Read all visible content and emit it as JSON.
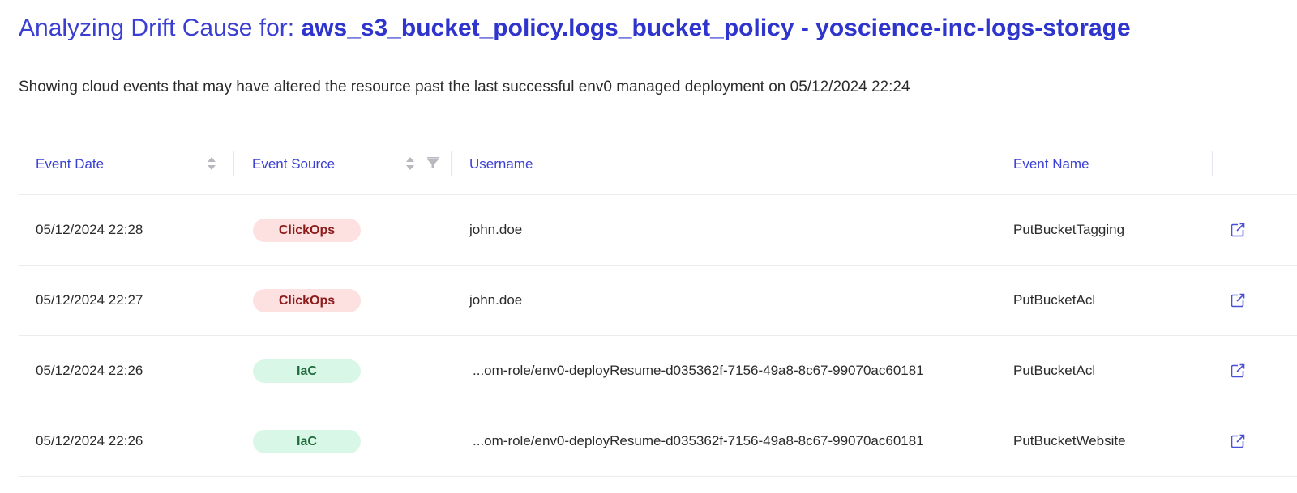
{
  "page": {
    "title_prefix": "Analyzing Drift Cause for: ",
    "title_resource": "aws_s3_bucket_policy.logs_bucket_policy - yoscience-inc-logs-storage",
    "subtitle": "Showing cloud events that may have altered the resource past the last successful env0 managed deployment on 05/12/2024 22:24"
  },
  "table": {
    "columns": [
      "Event Date",
      "Event Source",
      "Username",
      "Event Name"
    ],
    "rows": [
      {
        "date": "05/12/2024 22:28",
        "source": "ClickOps",
        "username": "john.doe",
        "event": "PutBucketTagging"
      },
      {
        "date": "05/12/2024 22:27",
        "source": "ClickOps",
        "username": "john.doe",
        "event": "PutBucketAcl"
      },
      {
        "date": "05/12/2024 22:26",
        "source": "IaC",
        "username": "...om-role/env0-deployResume-d035362f-7156-49a8-8c67-99070ac60181",
        "event": "PutBucketAcl"
      },
      {
        "date": "05/12/2024 22:26",
        "source": "IaC",
        "username": "...om-role/env0-deployResume-d035362f-7156-49a8-8c67-99070ac60181",
        "event": "PutBucketWebsite"
      }
    ]
  },
  "colors": {
    "accent": "#3a3fd1",
    "clickops_bg": "#fde0e0",
    "clickops_text": "#8c1c1c",
    "iac_bg": "#d9f7e6",
    "iac_text": "#1f6b3e"
  },
  "icons": {
    "sort": "sort-icon",
    "filter": "filter-icon",
    "open_link": "external-link-icon"
  }
}
